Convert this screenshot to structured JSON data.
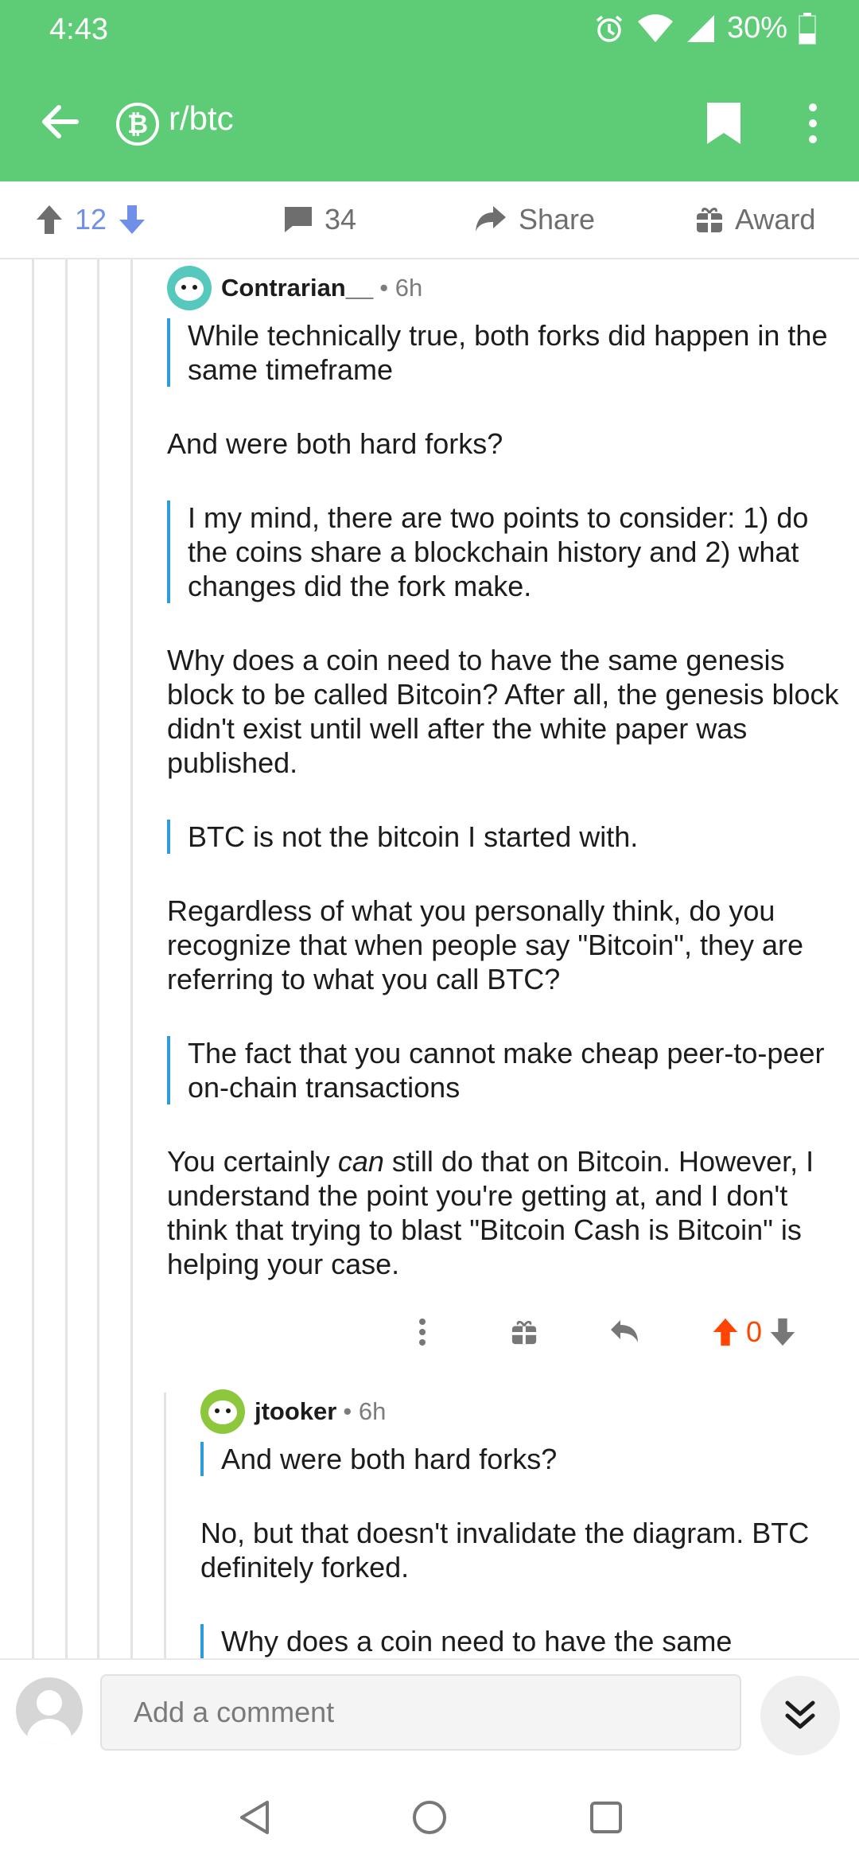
{
  "status_bar": {
    "time": "4:43",
    "battery": "30%"
  },
  "app_bar": {
    "subreddit": "r/btc",
    "sub_icon_glyph": "₿"
  },
  "post_actions": {
    "score": "12",
    "comments": "34",
    "share": "Share",
    "award": "Award"
  },
  "comments": [
    {
      "author": "Contrarian__",
      "age": "6h",
      "quote1": "While technically true, both forks did happen in the same timeframe",
      "para1": "And were both hard forks?",
      "quote2": "I my mind, there are two points to consider: 1) do the coins share a blockchain history and 2) what changes did the fork make.",
      "para2": "Why does a coin need to have the same genesis block to be called Bitcoin? After all, the genesis block didn't exist until well after the white paper was published.",
      "quote3": "BTC is not the bitcoin I started with.",
      "para3": "Regardless of what you personally think, do you recognize that when people say \"Bitcoin\", they are referring to what you call BTC?",
      "quote4": "The fact that you cannot make cheap peer-to-peer on-chain transactions",
      "para4_pre": "You certainly ",
      "para4_em": "can",
      "para4_post": " still do that on Bitcoin. However, I understand the point you're getting at, and I don't think that trying to blast \"Bitcoin Cash is Bitcoin\" is helping your case.",
      "score": "0"
    },
    {
      "author": "jtooker",
      "age": "6h",
      "quote1": "And were both hard forks?",
      "para1": "No, but that doesn't invalidate the diagram.  BTC definitely forked.",
      "quote2": "Why does a coin need to have the same"
    }
  ],
  "compose": {
    "placeholder": "Add a comment"
  },
  "colors": {
    "brand_green": "#5ecb77",
    "upvote_blue": "#6f8fe8",
    "upvoted_orange": "#ff4500",
    "quote_bar": "#2d9cdb"
  },
  "icons": [
    "back-arrow-icon",
    "bitcoin-icon",
    "bookmark-icon",
    "more-vert-icon",
    "upvote-icon",
    "downvote-icon",
    "comment-icon",
    "share-icon",
    "award-icon",
    "reply-icon",
    "chevron-double-down-icon",
    "nav-back-icon",
    "nav-home-icon",
    "nav-recents-icon"
  ]
}
